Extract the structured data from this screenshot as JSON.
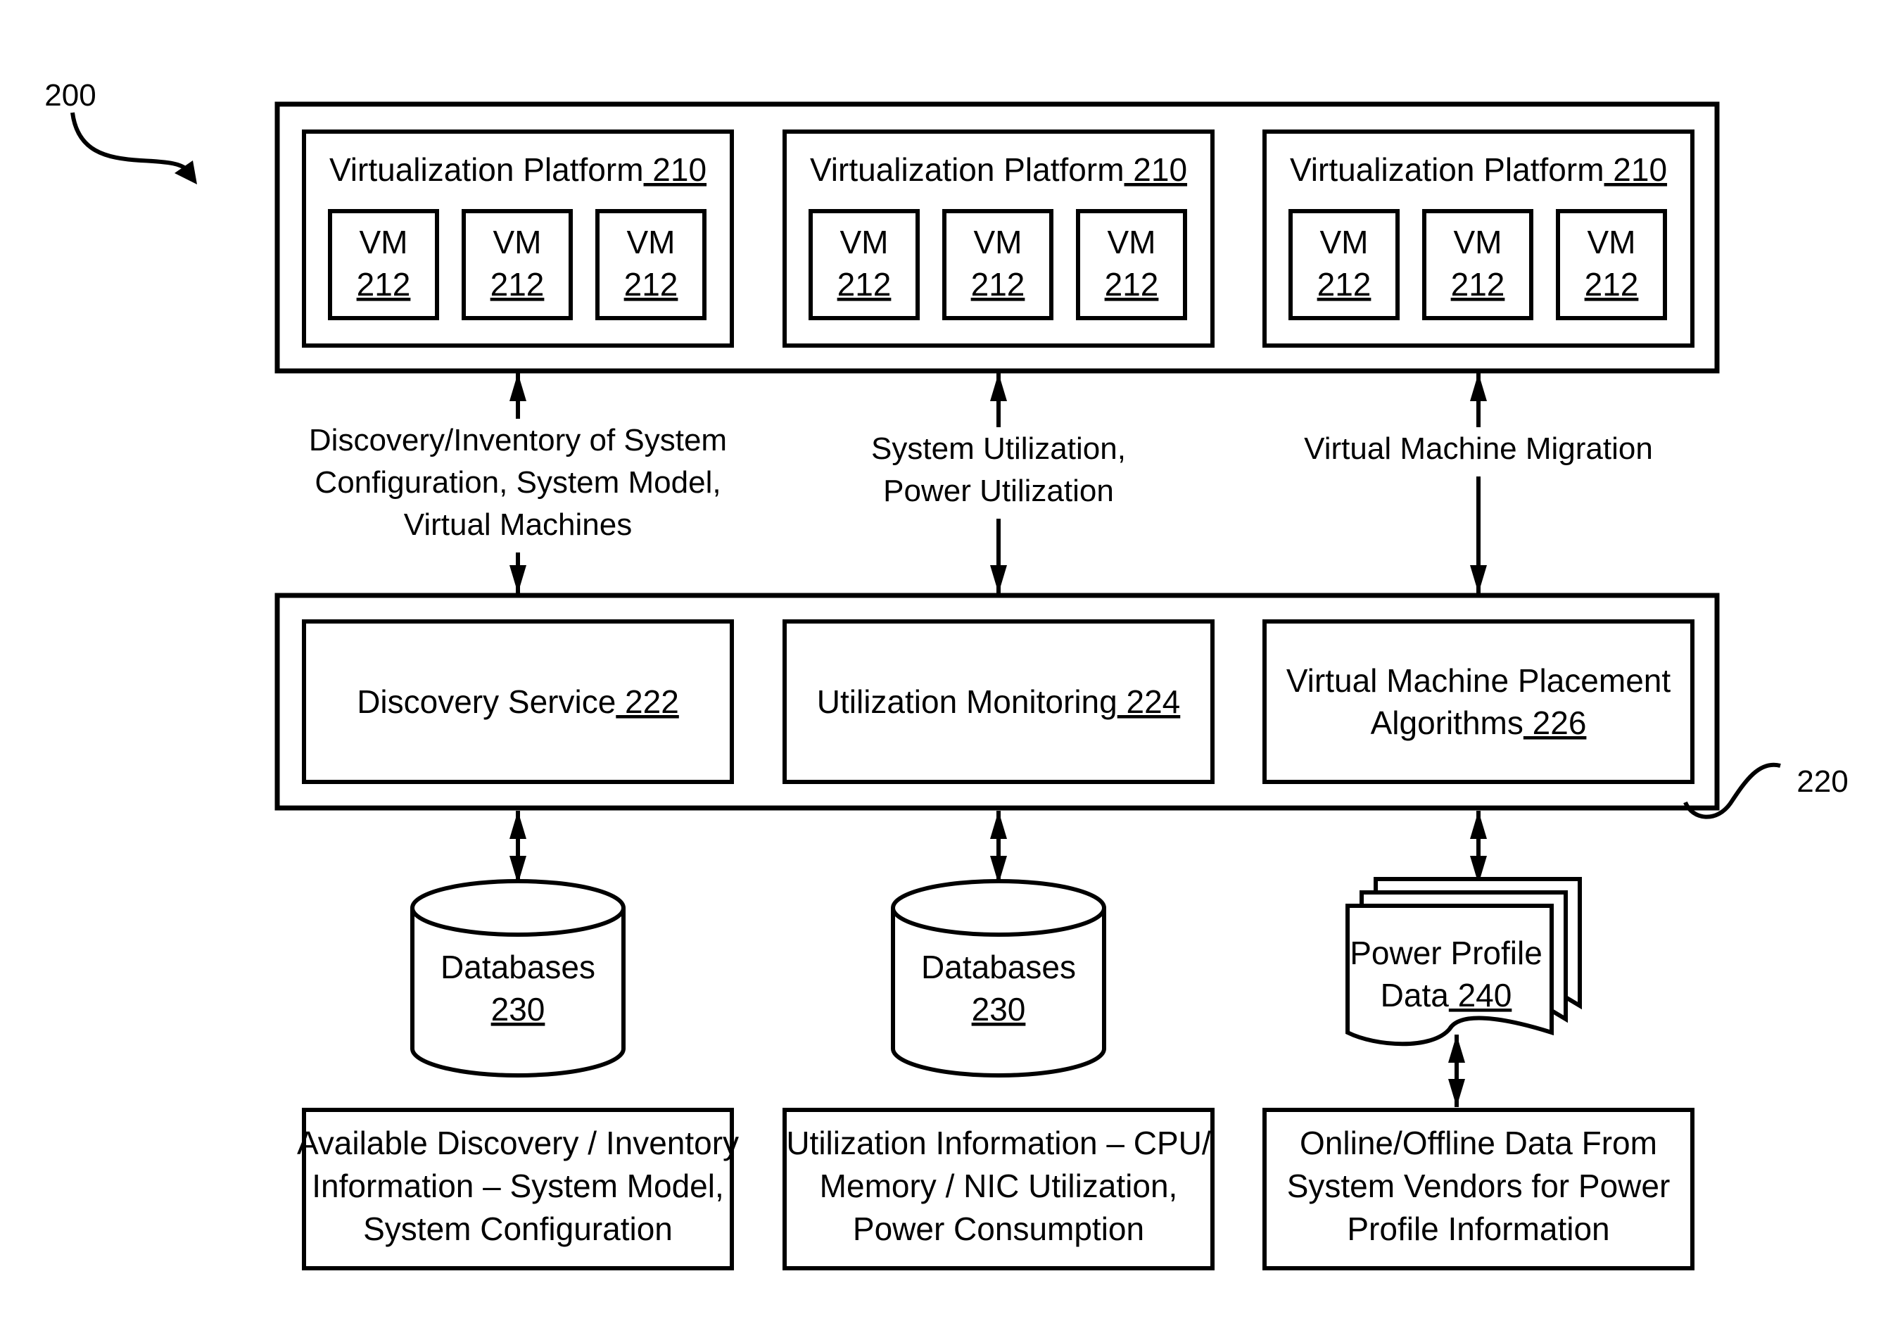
{
  "figure": {
    "ref_label": "200",
    "colors": {
      "stroke": "#000000",
      "background": "#ffffff"
    }
  },
  "top_group": {
    "platforms": [
      {
        "title": "Virtualization Platform",
        "ref": "210",
        "vms": [
          {
            "label": "VM",
            "ref": "212"
          },
          {
            "label": "VM",
            "ref": "212"
          },
          {
            "label": "VM",
            "ref": "212"
          }
        ]
      },
      {
        "title": "Virtualization Platform",
        "ref": "210",
        "vms": [
          {
            "label": "VM",
            "ref": "212"
          },
          {
            "label": "VM",
            "ref": "212"
          },
          {
            "label": "VM",
            "ref": "212"
          }
        ]
      },
      {
        "title": "Virtualization Platform",
        "ref": "210",
        "vms": [
          {
            "label": "VM",
            "ref": "212"
          },
          {
            "label": "VM",
            "ref": "212"
          },
          {
            "label": "VM",
            "ref": "212"
          }
        ]
      }
    ]
  },
  "connectors_top": [
    {
      "lines": [
        "Discovery/Inventory of System",
        "Configuration, System Model,",
        "Virtual Machines"
      ]
    },
    {
      "lines": [
        "System Utilization,",
        "Power Utilization"
      ]
    },
    {
      "lines": [
        "Virtual Machine Migration"
      ]
    }
  ],
  "middle_group": {
    "ref_label": "220",
    "services": [
      {
        "lines": [
          "Discovery Service"
        ],
        "ref": "222"
      },
      {
        "lines": [
          "Utilization Monitoring"
        ],
        "ref": "224"
      },
      {
        "lines": [
          "Virtual Machine Placement",
          "Algorithms"
        ],
        "ref": "226"
      }
    ]
  },
  "stores": [
    {
      "type": "database",
      "label": "Databases",
      "ref": "230"
    },
    {
      "type": "database",
      "label": "Databases",
      "ref": "230"
    },
    {
      "type": "document-stack",
      "lines": [
        "Power Profile",
        "Data"
      ],
      "ref": "240"
    }
  ],
  "info_boxes": [
    {
      "lines": [
        "Available Discovery / Inventory",
        "Information – System Model,",
        "System Configuration"
      ]
    },
    {
      "lines": [
        "Utilization Information – CPU/",
        "Memory / NIC Utilization,",
        "Power Consumption"
      ]
    },
    {
      "lines": [
        "Online/Offline Data From",
        "System Vendors for Power",
        "Profile Information"
      ]
    }
  ]
}
